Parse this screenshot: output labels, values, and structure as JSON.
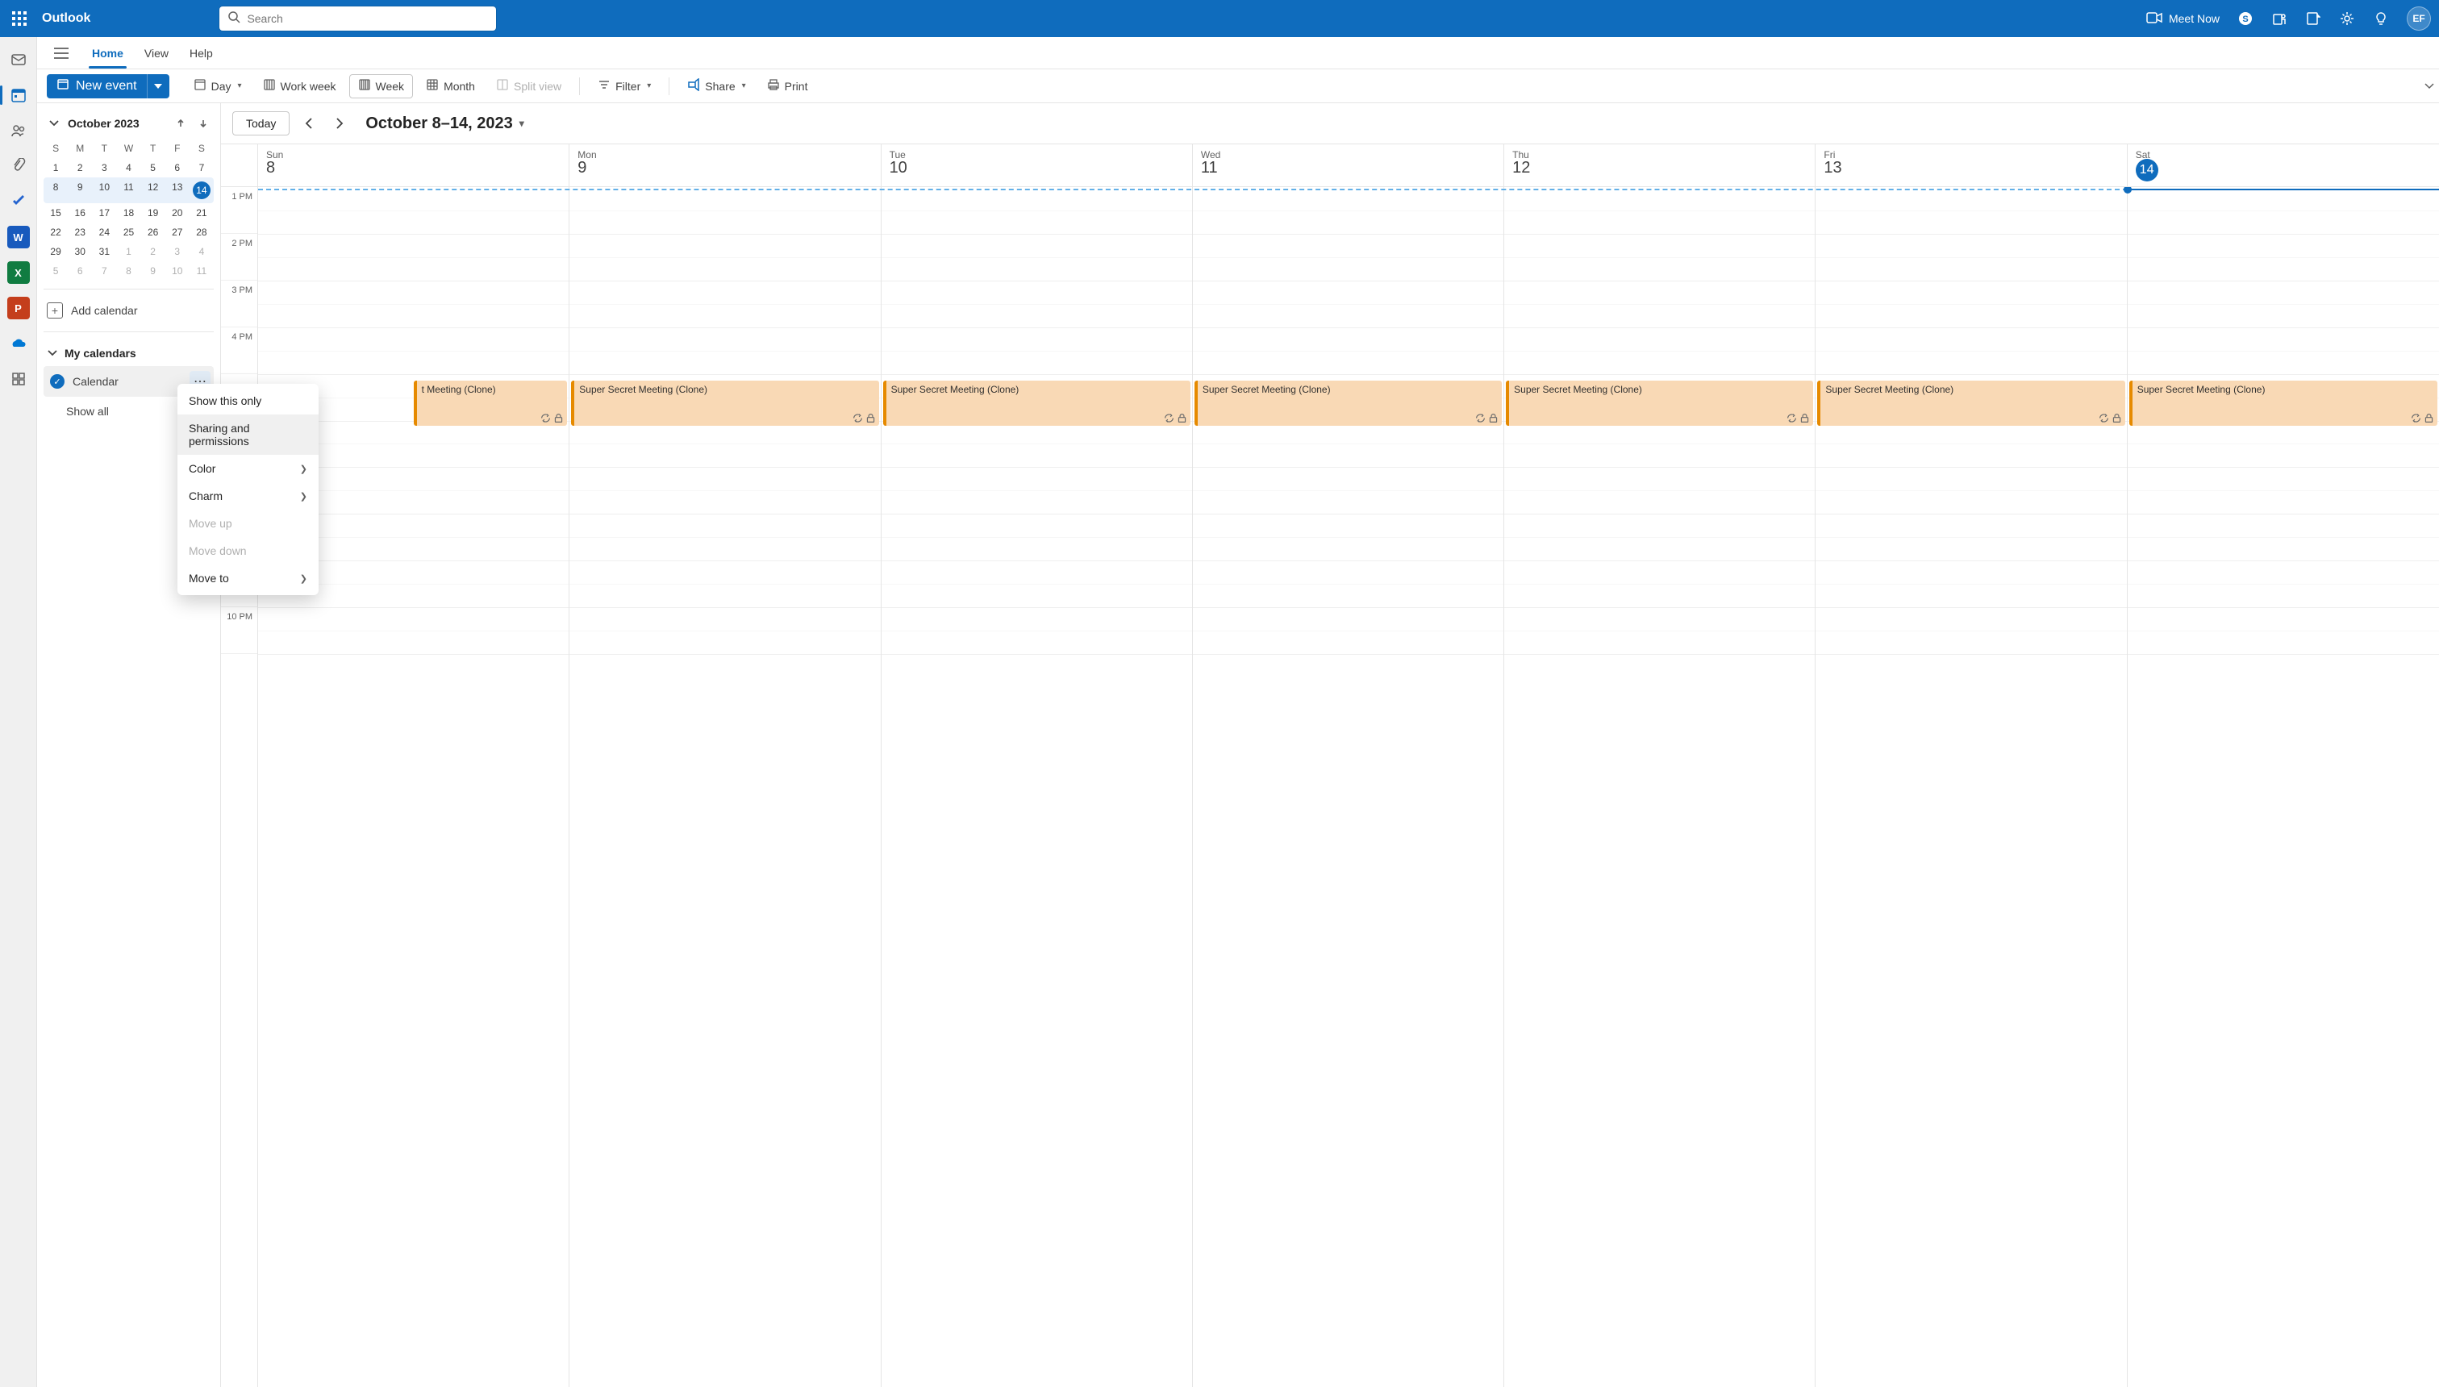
{
  "topbar": {
    "brand": "Outlook",
    "search_placeholder": "Search",
    "meet_now": "Meet Now",
    "avatar": "EF"
  },
  "tabs": {
    "home": "Home",
    "view": "View",
    "help": "Help"
  },
  "toolbar": {
    "new_event": "New event",
    "day": "Day",
    "work_week": "Work week",
    "week": "Week",
    "month": "Month",
    "split_view": "Split view",
    "filter": "Filter",
    "share": "Share",
    "print": "Print"
  },
  "minical": {
    "title": "October 2023",
    "dow": [
      "S",
      "M",
      "T",
      "W",
      "T",
      "F",
      "S"
    ],
    "rows": [
      [
        {
          "n": "1"
        },
        {
          "n": "2"
        },
        {
          "n": "3"
        },
        {
          "n": "4"
        },
        {
          "n": "5"
        },
        {
          "n": "6"
        },
        {
          "n": "7"
        }
      ],
      [
        {
          "n": "8",
          "w": 1,
          "f": 1
        },
        {
          "n": "9",
          "w": 1
        },
        {
          "n": "10",
          "w": 1
        },
        {
          "n": "11",
          "w": 1
        },
        {
          "n": "12",
          "w": 1
        },
        {
          "n": "13",
          "w": 1
        },
        {
          "n": "14",
          "w": 1,
          "t": 1
        }
      ],
      [
        {
          "n": "15"
        },
        {
          "n": "16"
        },
        {
          "n": "17"
        },
        {
          "n": "18"
        },
        {
          "n": "19"
        },
        {
          "n": "20"
        },
        {
          "n": "21"
        }
      ],
      [
        {
          "n": "22"
        },
        {
          "n": "23"
        },
        {
          "n": "24"
        },
        {
          "n": "25"
        },
        {
          "n": "26"
        },
        {
          "n": "27"
        },
        {
          "n": "28"
        }
      ],
      [
        {
          "n": "29"
        },
        {
          "n": "30"
        },
        {
          "n": "31"
        },
        {
          "n": "1",
          "o": 1
        },
        {
          "n": "2",
          "o": 1
        },
        {
          "n": "3",
          "o": 1
        },
        {
          "n": "4",
          "o": 1
        }
      ],
      [
        {
          "n": "5",
          "o": 1
        },
        {
          "n": "6",
          "o": 1
        },
        {
          "n": "7",
          "o": 1
        },
        {
          "n": "8",
          "o": 1
        },
        {
          "n": "9",
          "o": 1
        },
        {
          "n": "10",
          "o": 1
        },
        {
          "n": "11",
          "o": 1
        }
      ]
    ]
  },
  "sidebar": {
    "add_calendar": "Add calendar",
    "my_calendars": "My calendars",
    "calendar_name": "Calendar",
    "show_all": "Show all"
  },
  "ctxmenu": {
    "show_this_only": "Show this only",
    "sharing": "Sharing and permissions",
    "color": "Color",
    "charm": "Charm",
    "move_up": "Move up",
    "move_down": "Move down",
    "move_to": "Move to"
  },
  "calhead": {
    "today": "Today",
    "range": "October 8–14, 2023"
  },
  "days": [
    {
      "dow": "Sun",
      "num": "8"
    },
    {
      "dow": "Mon",
      "num": "9"
    },
    {
      "dow": "Tue",
      "num": "10"
    },
    {
      "dow": "Wed",
      "num": "11"
    },
    {
      "dow": "Thu",
      "num": "12"
    },
    {
      "dow": "Fri",
      "num": "13"
    },
    {
      "dow": "Sat",
      "num": "14",
      "today": true
    }
  ],
  "timeslots": [
    "1 PM",
    "2 PM",
    "3 PM",
    "4 PM",
    "",
    "",
    "",
    "",
    "",
    "10 PM"
  ],
  "event_titles": {
    "sun": "t Meeting (Clone)",
    "mon": "Super Secret Meeting (Clone)",
    "tue": "Super Secret Meeting (Clone)",
    "wed": "Super Secret Meeting (Clone)",
    "thu": "Super Secret Meeting (Clone)",
    "fri": "Super Secret Meeting (Clone)",
    "sat": "Super Secret Meeting (Clone)"
  }
}
